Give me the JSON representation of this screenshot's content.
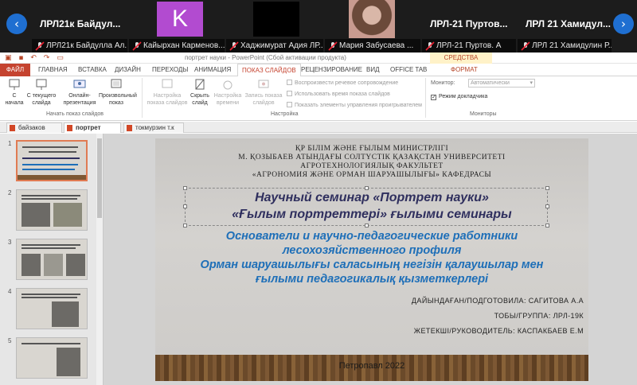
{
  "conference": {
    "participants": [
      {
        "tile_name": "ЛРЛ21к Байдул...",
        "caption": "ЛРЛ21к Байдулла Ал..."
      },
      {
        "avatar_letter": "K",
        "caption": "Кайырхан Карменов..."
      },
      {
        "caption": "Хаджимурат Адия ЛР..."
      },
      {
        "caption": "Мария Забусаева ..."
      },
      {
        "tile_name": "ЛРЛ-21 Пуртов...",
        "caption": "ЛРЛ-21 Пуртов. А"
      },
      {
        "tile_name": "ЛРЛ 21 Хамидул...",
        "caption": "ЛРЛ 21 Хамидулин Р..."
      }
    ]
  },
  "window": {
    "title": "портрет науки - PowerPoint (Сбой активации продукта)",
    "tools_header": "СРЕДСТВА РИСОВАНИЯ"
  },
  "ribbon_tabs": [
    "ФАЙЛ",
    "ГЛАВНАЯ",
    "ВСТАВКА",
    "ДИЗАЙН",
    "ПЕРЕХОДЫ",
    "АНИМАЦИЯ",
    "ПОКАЗ СЛАЙДОВ",
    "РЕЦЕНЗИРОВАНИЕ",
    "ВИД",
    "OFFICE TAB",
    "ФОРМАТ"
  ],
  "ribbon": {
    "btn_from_start": "С начала",
    "btn_from_current": "С текущего слайда",
    "btn_online": "Онлайн-презентация",
    "btn_custom": "Произвольный показ",
    "group_start": "Начать показ слайдов",
    "btn_setup": "Настройка показа слайдов",
    "btn_hide": "Скрыть слайд",
    "btn_rehearse": "Настройка времени",
    "btn_record": "Запись показа слайдов",
    "chk_narration": "Воспроизвести речевое сопровождение",
    "chk_timings": "Использовать время показа слайдов",
    "chk_controls": "Показать элементы управления проигрывателем",
    "group_setup": "Настройка",
    "monitor_label": "Монитор:",
    "monitor_value": "Автоматически",
    "chk_presenter": "Режим докладчика",
    "group_monitors": "Мониторы"
  },
  "doc_tabs": [
    {
      "label": "байзаков"
    },
    {
      "label": "портрет науки",
      "active": true
    },
    {
      "label": "токмурзин т.к"
    }
  ],
  "thumb_numbers": [
    "1",
    "2",
    "3",
    "4",
    "5"
  ],
  "slide": {
    "inst1": "ҚР БІЛІМ ЖӘНЕ ҒЫЛЫМ МИНИСТРЛІГІ",
    "inst2": "М. ҚОЗЫБАЕВ АТЫНДАҒЫ СОЛТҮСТІК ҚАЗАҚСТАН УНИВЕРСИТЕТІ",
    "inst3": "АГРОТЕХНОЛОГИЯЛЫҚ ФАКУЛЬТЕТ",
    "inst4": "«АГРОНОМИЯ ЖӘНЕ ОРМАН ШАРУАШЫЛЫҒЫ» КАФЕДРАСЫ",
    "title1": "Научный семинар «Портрет науки»",
    "title2": "«Ғылым портреттері» ғылыми семинары",
    "sub1": "Основатели и научно-педагогические работники",
    "sub2": "лесохозяйственного профиля",
    "sub3": "Орман шаруашылығы саласының негізін қалаушылар мен",
    "sub4": "ғылыми педагогикалық қызметкерлері",
    "author1": "ДАЙЫНДАҒАН/ПОДГОТОВИЛА: САГИТОВА А.А",
    "author2": "ТОБЫ/ГРУППА: ЛРЛ-19К",
    "author3": "ЖЕТЕКШІ/РУКОВОДИТЕЛЬ: КАСПАКБАЕВ Е.М",
    "city": "Петропавл 2022"
  }
}
